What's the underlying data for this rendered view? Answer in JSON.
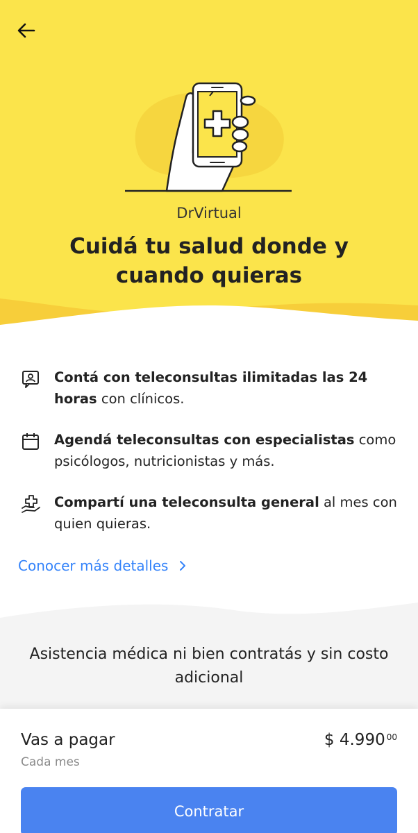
{
  "colors": {
    "hero_yellow": "#fbe44b",
    "hero_wave": "#f7ce3a",
    "accent_blue": "#3483fa",
    "cta_blue": "#4a83f0",
    "gray_bg": "#f4f4f4"
  },
  "header": {
    "back_icon": "arrow-left-icon"
  },
  "hero": {
    "illustration": "hand-holding-phone-medical-cross",
    "brand": "DrVirtual",
    "title": "Cuidá tu salud donde y cuando quieras"
  },
  "benefits": [
    {
      "icon": "doctor-chat-icon",
      "bold": "Contá con teleconsultas ilimitadas las 24 horas",
      "text": " con clínicos."
    },
    {
      "icon": "calendar-icon",
      "bold": "Agendá teleconsultas con especialistas",
      "text": " como psicólogos, nutricionistas y más."
    },
    {
      "icon": "hand-cross-icon",
      "bold": "Compartí una teleconsulta general",
      "text": " al mes con quien quieras."
    }
  ],
  "more_details": {
    "label": "Conocer más detalles",
    "icon": "chevron-right-icon"
  },
  "assistance": {
    "text": "Asistencia médica ni bien contratás y sin costo adicional"
  },
  "footer": {
    "pay_label": "Vas a pagar",
    "period": "Cada mes",
    "price_main": "$ 4.990",
    "price_cents": "00",
    "cta_label": "Contratar"
  }
}
